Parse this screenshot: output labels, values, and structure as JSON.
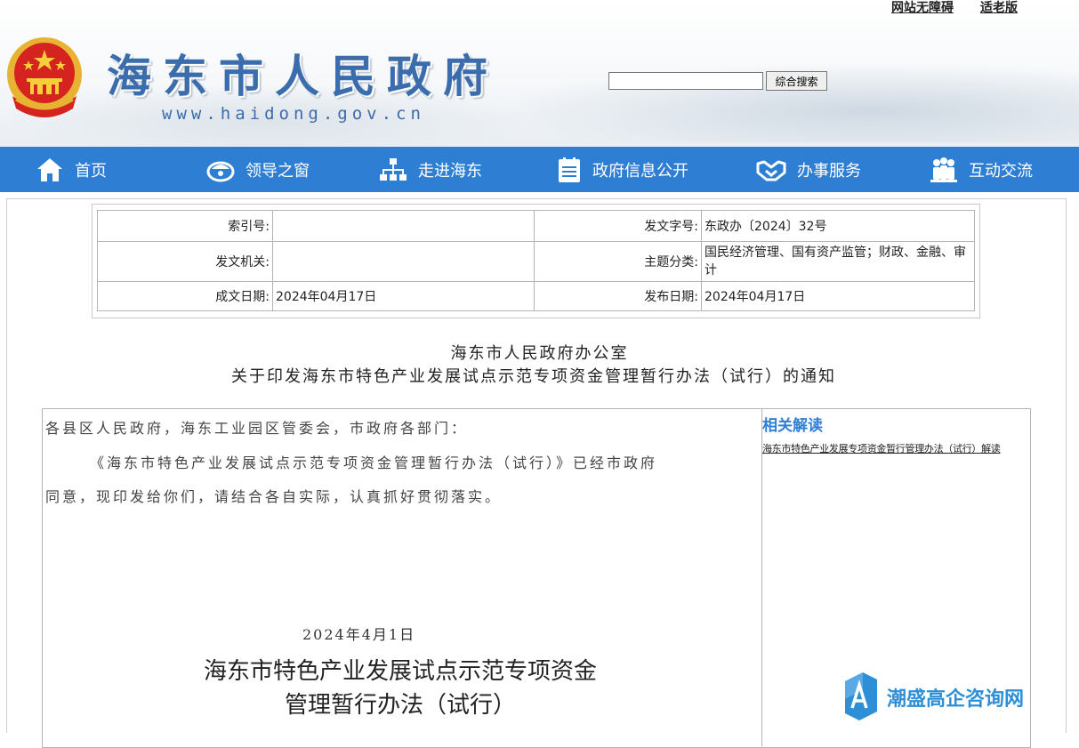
{
  "top_links": {
    "accessibility": "网站无障碍",
    "elderly": "适老版"
  },
  "header": {
    "title": "海东市人民政府",
    "url": "www.haidong.gov.cn"
  },
  "search": {
    "value": "",
    "button": "综合搜索"
  },
  "nav": [
    {
      "label": "首页",
      "icon": "home-icon"
    },
    {
      "label": "领导之窗",
      "icon": "leader-icon"
    },
    {
      "label": "走进海东",
      "icon": "org-chart-icon"
    },
    {
      "label": "政府信息公开",
      "icon": "document-list-icon"
    },
    {
      "label": "办事服务",
      "icon": "handshake-icon"
    },
    {
      "label": "互动交流",
      "icon": "people-icon"
    }
  ],
  "meta": {
    "index_label": "索引号:",
    "index_value": "",
    "doc_no_label": "发文字号:",
    "doc_no_value": "东政办〔2024〕32号",
    "issuer_label": "发文机关:",
    "issuer_value": "",
    "topic_label": "主题分类:",
    "topic_value": "国民经济管理、国有资产监管；财政、金融、审计",
    "written_label": "成文日期:",
    "written_value": "2024年04月17日",
    "publish_label": "发布日期:",
    "publish_value": "2024年04月17日"
  },
  "document": {
    "title_line1": "海东市人民政府办公室",
    "title_line2": "关于印发海东市特色产业发展试点示范专项资金管理暂行办法（试行）的通知",
    "salutation": "各县区人民政府，海东工业园区管委会，市政府各部门：",
    "body_line1": "《海东市特色产业发展试点示范专项资金管理暂行办法（试行）》已经市政府",
    "body_line2": "同意，现印发给你们，请结合各自实际，认真抓好贯彻落实。",
    "date": "2024年4月1日",
    "attachment_title_line1": "海东市特色产业发展试点示范专项资金",
    "attachment_title_line2": "管理暂行办法（试行）"
  },
  "related": {
    "heading": "相关解读",
    "link": "海东市特色产业发展专项资金暂行管理办法（试行）解读"
  },
  "watermark": {
    "text": "潮盛高企咨询网"
  },
  "colors": {
    "nav_bg": "#2e7fd3",
    "title_blue": "#3b6cab",
    "accent": "#2e8fd6"
  }
}
